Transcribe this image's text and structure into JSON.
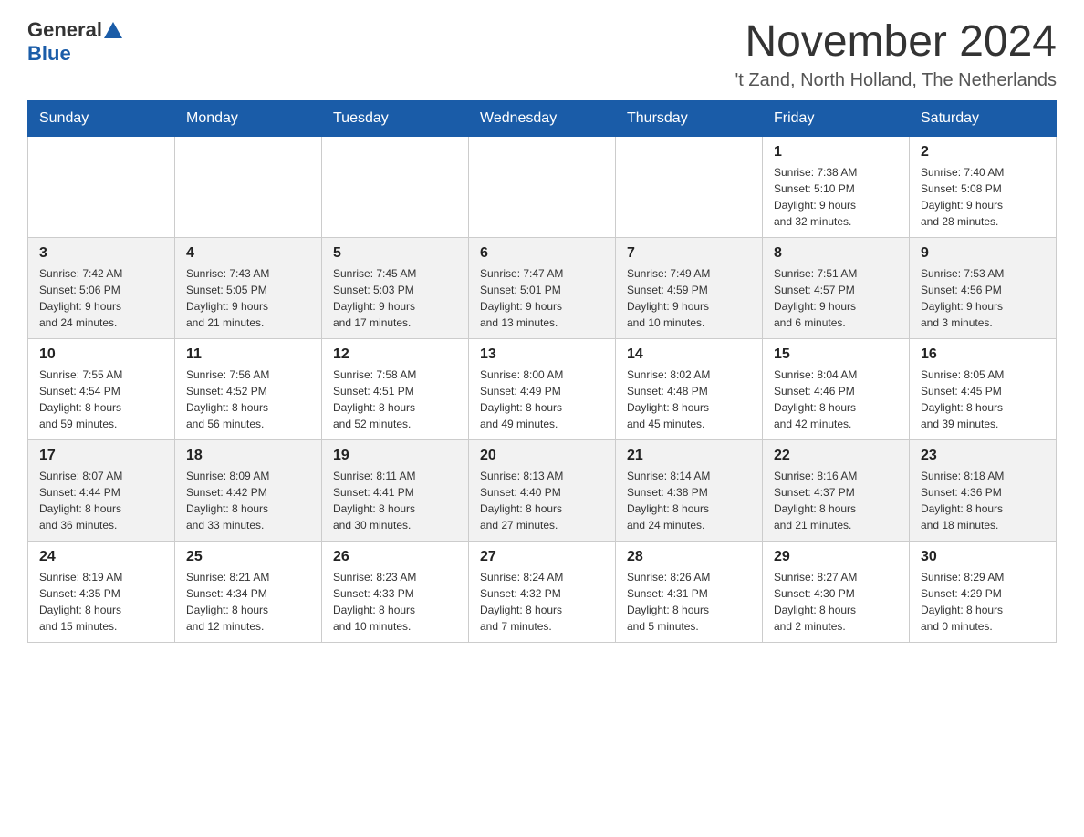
{
  "header": {
    "logo_general": "General",
    "logo_blue": "Blue",
    "month_title": "November 2024",
    "location": "'t Zand, North Holland, The Netherlands"
  },
  "days_of_week": [
    "Sunday",
    "Monday",
    "Tuesday",
    "Wednesday",
    "Thursday",
    "Friday",
    "Saturday"
  ],
  "weeks": [
    [
      {
        "day": "",
        "info": ""
      },
      {
        "day": "",
        "info": ""
      },
      {
        "day": "",
        "info": ""
      },
      {
        "day": "",
        "info": ""
      },
      {
        "day": "",
        "info": ""
      },
      {
        "day": "1",
        "info": "Sunrise: 7:38 AM\nSunset: 5:10 PM\nDaylight: 9 hours\nand 32 minutes."
      },
      {
        "day": "2",
        "info": "Sunrise: 7:40 AM\nSunset: 5:08 PM\nDaylight: 9 hours\nand 28 minutes."
      }
    ],
    [
      {
        "day": "3",
        "info": "Sunrise: 7:42 AM\nSunset: 5:06 PM\nDaylight: 9 hours\nand 24 minutes."
      },
      {
        "day": "4",
        "info": "Sunrise: 7:43 AM\nSunset: 5:05 PM\nDaylight: 9 hours\nand 21 minutes."
      },
      {
        "day": "5",
        "info": "Sunrise: 7:45 AM\nSunset: 5:03 PM\nDaylight: 9 hours\nand 17 minutes."
      },
      {
        "day": "6",
        "info": "Sunrise: 7:47 AM\nSunset: 5:01 PM\nDaylight: 9 hours\nand 13 minutes."
      },
      {
        "day": "7",
        "info": "Sunrise: 7:49 AM\nSunset: 4:59 PM\nDaylight: 9 hours\nand 10 minutes."
      },
      {
        "day": "8",
        "info": "Sunrise: 7:51 AM\nSunset: 4:57 PM\nDaylight: 9 hours\nand 6 minutes."
      },
      {
        "day": "9",
        "info": "Sunrise: 7:53 AM\nSunset: 4:56 PM\nDaylight: 9 hours\nand 3 minutes."
      }
    ],
    [
      {
        "day": "10",
        "info": "Sunrise: 7:55 AM\nSunset: 4:54 PM\nDaylight: 8 hours\nand 59 minutes."
      },
      {
        "day": "11",
        "info": "Sunrise: 7:56 AM\nSunset: 4:52 PM\nDaylight: 8 hours\nand 56 minutes."
      },
      {
        "day": "12",
        "info": "Sunrise: 7:58 AM\nSunset: 4:51 PM\nDaylight: 8 hours\nand 52 minutes."
      },
      {
        "day": "13",
        "info": "Sunrise: 8:00 AM\nSunset: 4:49 PM\nDaylight: 8 hours\nand 49 minutes."
      },
      {
        "day": "14",
        "info": "Sunrise: 8:02 AM\nSunset: 4:48 PM\nDaylight: 8 hours\nand 45 minutes."
      },
      {
        "day": "15",
        "info": "Sunrise: 8:04 AM\nSunset: 4:46 PM\nDaylight: 8 hours\nand 42 minutes."
      },
      {
        "day": "16",
        "info": "Sunrise: 8:05 AM\nSunset: 4:45 PM\nDaylight: 8 hours\nand 39 minutes."
      }
    ],
    [
      {
        "day": "17",
        "info": "Sunrise: 8:07 AM\nSunset: 4:44 PM\nDaylight: 8 hours\nand 36 minutes."
      },
      {
        "day": "18",
        "info": "Sunrise: 8:09 AM\nSunset: 4:42 PM\nDaylight: 8 hours\nand 33 minutes."
      },
      {
        "day": "19",
        "info": "Sunrise: 8:11 AM\nSunset: 4:41 PM\nDaylight: 8 hours\nand 30 minutes."
      },
      {
        "day": "20",
        "info": "Sunrise: 8:13 AM\nSunset: 4:40 PM\nDaylight: 8 hours\nand 27 minutes."
      },
      {
        "day": "21",
        "info": "Sunrise: 8:14 AM\nSunset: 4:38 PM\nDaylight: 8 hours\nand 24 minutes."
      },
      {
        "day": "22",
        "info": "Sunrise: 8:16 AM\nSunset: 4:37 PM\nDaylight: 8 hours\nand 21 minutes."
      },
      {
        "day": "23",
        "info": "Sunrise: 8:18 AM\nSunset: 4:36 PM\nDaylight: 8 hours\nand 18 minutes."
      }
    ],
    [
      {
        "day": "24",
        "info": "Sunrise: 8:19 AM\nSunset: 4:35 PM\nDaylight: 8 hours\nand 15 minutes."
      },
      {
        "day": "25",
        "info": "Sunrise: 8:21 AM\nSunset: 4:34 PM\nDaylight: 8 hours\nand 12 minutes."
      },
      {
        "day": "26",
        "info": "Sunrise: 8:23 AM\nSunset: 4:33 PM\nDaylight: 8 hours\nand 10 minutes."
      },
      {
        "day": "27",
        "info": "Sunrise: 8:24 AM\nSunset: 4:32 PM\nDaylight: 8 hours\nand 7 minutes."
      },
      {
        "day": "28",
        "info": "Sunrise: 8:26 AM\nSunset: 4:31 PM\nDaylight: 8 hours\nand 5 minutes."
      },
      {
        "day": "29",
        "info": "Sunrise: 8:27 AM\nSunset: 4:30 PM\nDaylight: 8 hours\nand 2 minutes."
      },
      {
        "day": "30",
        "info": "Sunrise: 8:29 AM\nSunset: 4:29 PM\nDaylight: 8 hours\nand 0 minutes."
      }
    ]
  ]
}
